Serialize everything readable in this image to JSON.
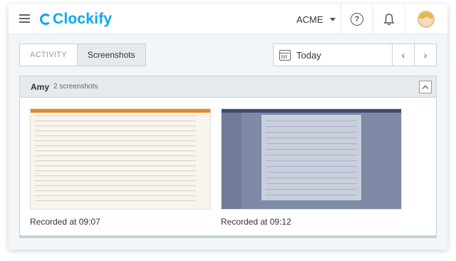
{
  "app": {
    "logo_text": "Clockify",
    "workspace": "ACME",
    "help_label": "?"
  },
  "tabs": [
    {
      "label": "ACTIVITY",
      "active": false
    },
    {
      "label": "Screenshots",
      "active": true
    }
  ],
  "date_range": {
    "label": "Today",
    "prev_label": "‹",
    "next_label": "›"
  },
  "user_group": {
    "name": "Amy",
    "count_label": "2 screenshots",
    "screenshots": [
      {
        "caption": "Recorded at 09:07"
      },
      {
        "caption": "Recorded at 09:12"
      }
    ]
  },
  "colors": {
    "brand": "#03a9f4",
    "header_bg": "#e4eaee",
    "border": "#c6d2d9"
  },
  "icons": [
    "menu-icon",
    "help-icon",
    "bell-icon",
    "user-avatar",
    "calendar-icon",
    "chevron-left-icon",
    "chevron-right-icon",
    "chevron-up-icon"
  ]
}
